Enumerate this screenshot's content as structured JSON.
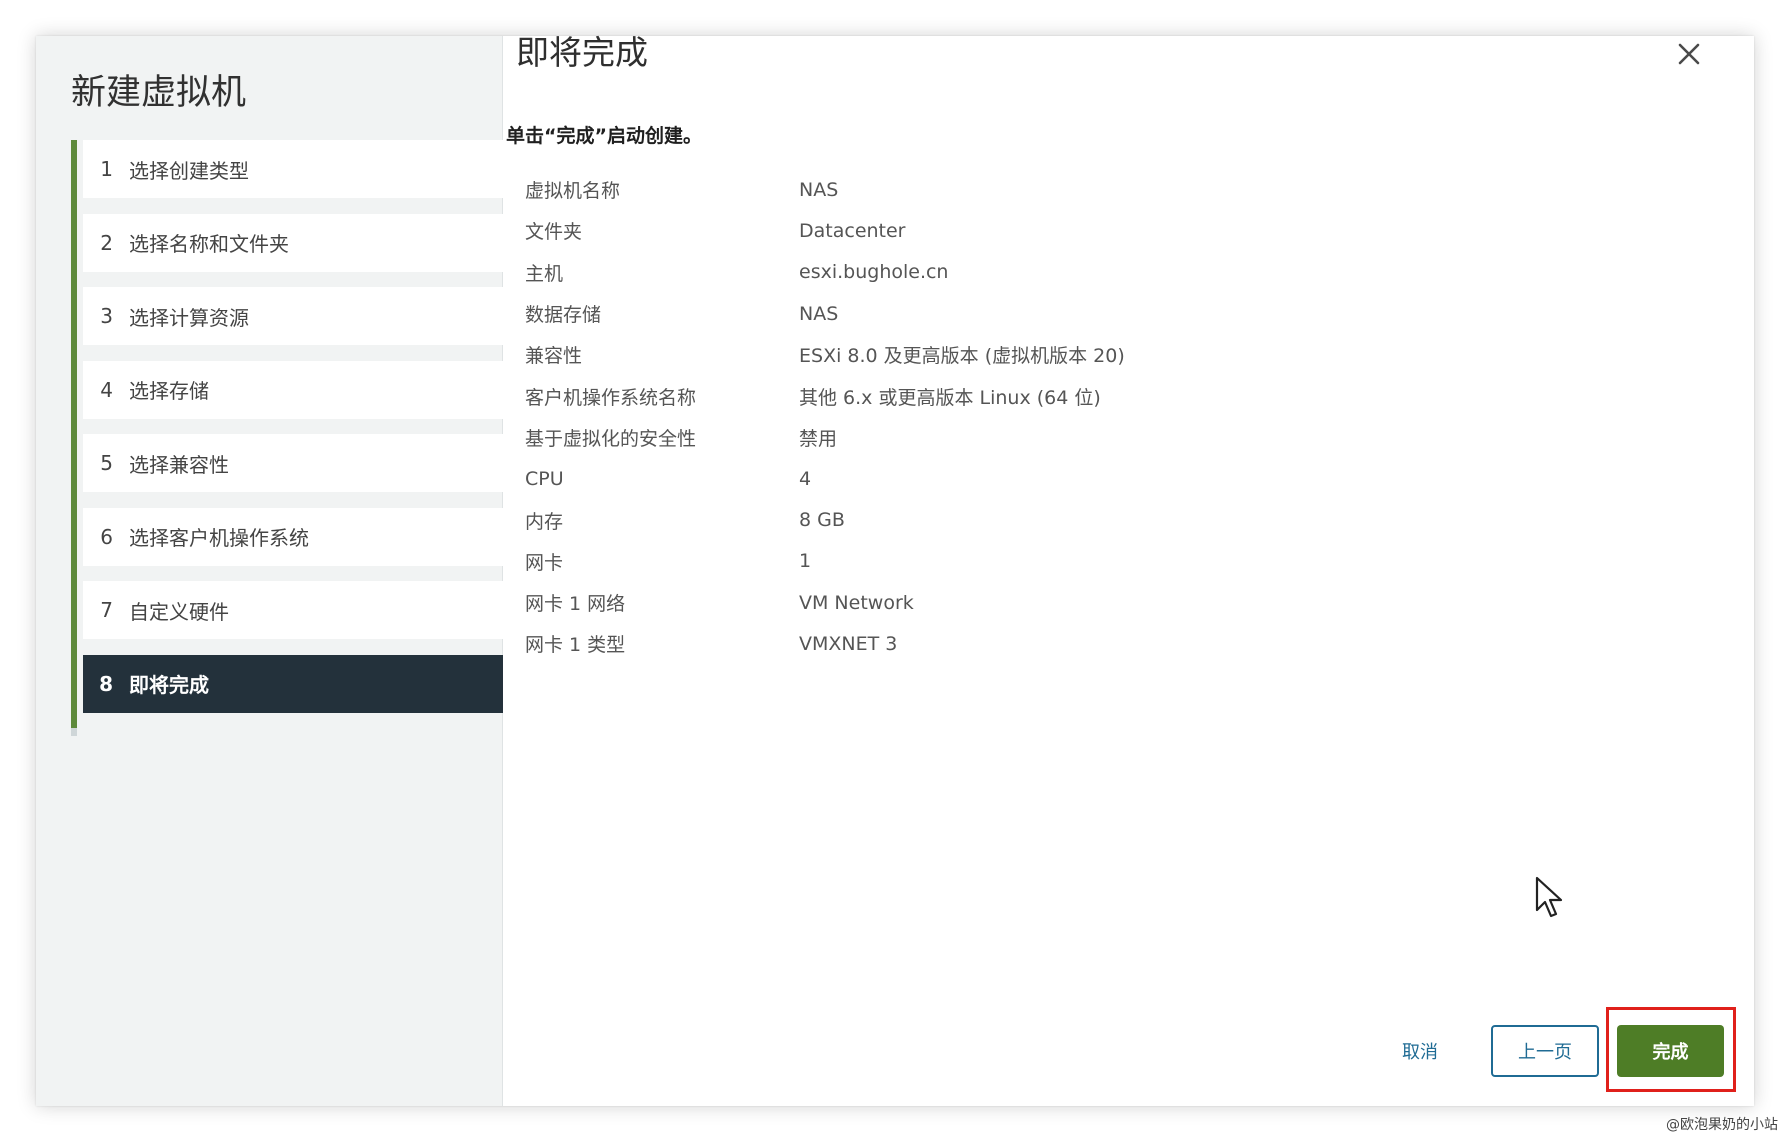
{
  "wizard": {
    "title": "新建虚拟机",
    "steps": [
      {
        "num": "1",
        "label": "选择创建类型"
      },
      {
        "num": "2",
        "label": "选择名称和文件夹"
      },
      {
        "num": "3",
        "label": "选择计算资源"
      },
      {
        "num": "4",
        "label": "选择存储"
      },
      {
        "num": "5",
        "label": "选择兼容性"
      },
      {
        "num": "6",
        "label": "选择客户机操作系统"
      },
      {
        "num": "7",
        "label": "自定义硬件"
      },
      {
        "num": "8",
        "label": "即将完成"
      }
    ],
    "active_step": 8
  },
  "page": {
    "title": "即将完成",
    "subtitle": "单击“完成”启动创建。"
  },
  "summary": [
    {
      "key": "虚拟机名称",
      "value": "NAS"
    },
    {
      "key": "文件夹",
      "value": "Datacenter"
    },
    {
      "key": "主机",
      "value": "esxi.bughole.cn"
    },
    {
      "key": "数据存储",
      "value": "NAS"
    },
    {
      "key": "兼容性",
      "value": "ESXi 8.0 及更高版本 (虚拟机版本 20)"
    },
    {
      "key": "客户机操作系统名称",
      "value": "其他 6.x 或更高版本 Linux (64 位)"
    },
    {
      "key": "基于虚拟化的安全性",
      "value": "禁用"
    },
    {
      "key": "CPU",
      "value": "4"
    },
    {
      "key": "内存",
      "value": "8 GB"
    },
    {
      "key": "网卡",
      "value": "1"
    },
    {
      "key": "网卡 1 网络",
      "value": "VM Network"
    },
    {
      "key": "网卡 1 类型",
      "value": "VMXNET 3"
    }
  ],
  "footer": {
    "cancel_label": "取消",
    "back_label": "上一页",
    "finish_label": "完成"
  },
  "watermark": "@欧泡果奶的小站",
  "colors": {
    "accent_green": "#4e7d26",
    "active_step_bg": "#23313b",
    "link_blue": "#1f6b94",
    "highlight_red": "#e0201b"
  },
  "icons": {
    "close": "close-icon",
    "cursor": "mouse-cursor-icon"
  }
}
